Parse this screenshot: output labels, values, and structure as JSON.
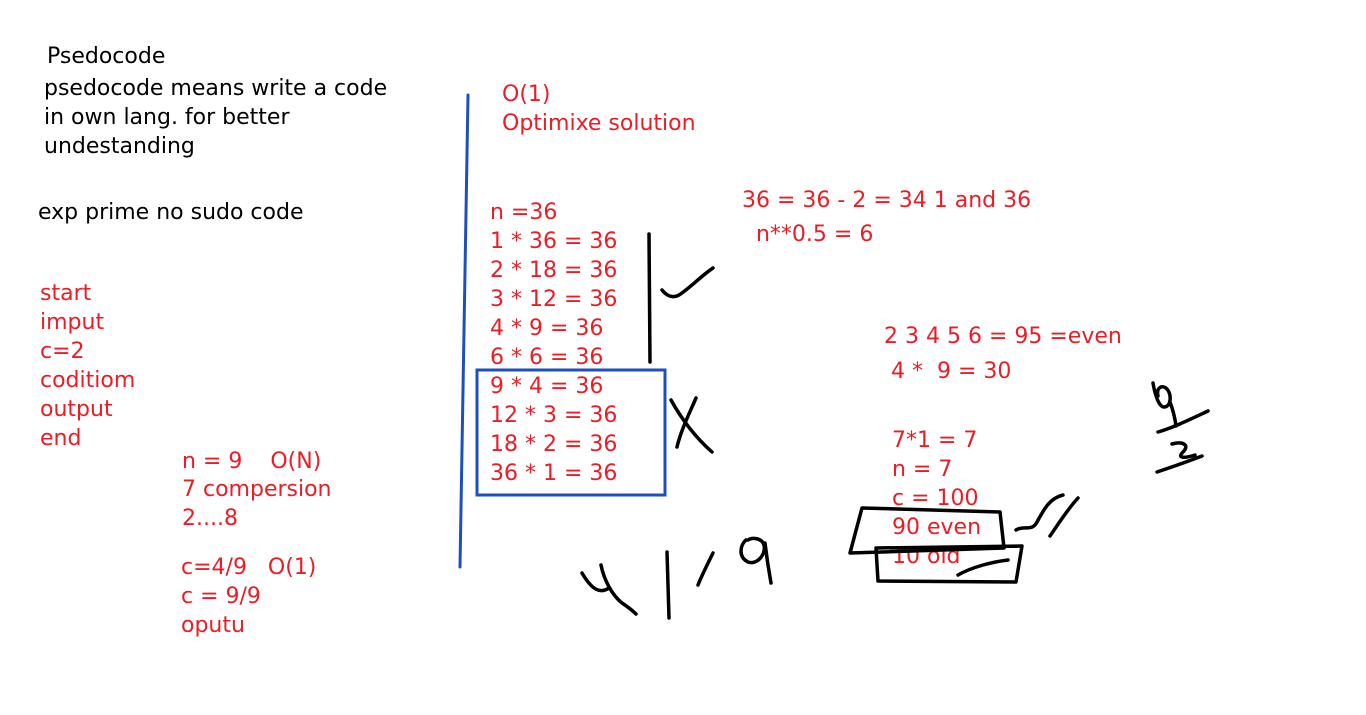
{
  "colors": {
    "black_ink": "#000000",
    "red_ink": "#ed1c24",
    "blue_ink": "#1f4fbf"
  },
  "heading": "Psedocode",
  "definition": [
    "psedocode means write a code",
    "in own lang. for better",
    "undestanding"
  ],
  "example_title": "exp prime no sudo code",
  "steps": [
    "start",
    "imput",
    "c=2",
    "coditiom",
    "output",
    "end"
  ],
  "note1": [
    "n = 9    O(N)",
    "7 compersion",
    "2....8"
  ],
  "note2": [
    "c=4/9   O(1)",
    "c = 9/9",
    "oputu"
  ],
  "optimize": [
    "O(1)",
    "Optimixe solution"
  ],
  "factors": [
    "n =36",
    "1 * 36 = 36",
    "2 * 18 = 36",
    "3 * 12 = 36",
    "4 * 9 = 36",
    "6 * 6 = 36"
  ],
  "factors_boxed": [
    "9 * 4 = 36",
    "12 * 3 = 36",
    "18 * 2 = 36",
    "36 * 1 = 36"
  ],
  "right_top": [
    "36 = 36 - 2 = 34 1 and 36",
    "  n**0.5 = 6"
  ],
  "right_mid": [
    "2 3 4 5 6 = 95 =even",
    " 4 *  9 = 30"
  ],
  "right_low": [
    "7*1 = 7",
    "n = 7",
    "c = 100",
    "90 even",
    "10 old"
  ]
}
